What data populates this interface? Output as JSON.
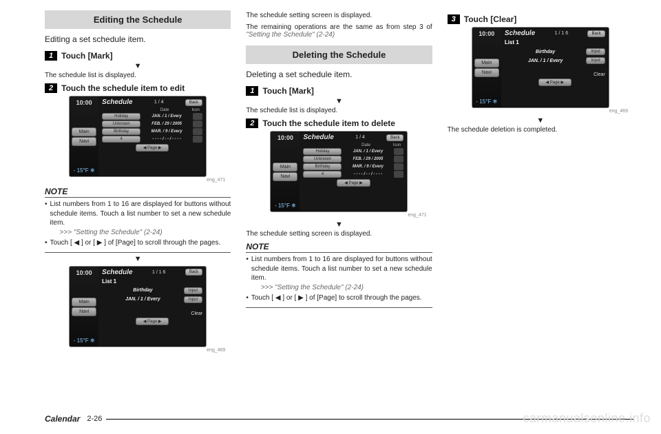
{
  "col1": {
    "section_title": "Editing the Schedule",
    "intro": "Editing a set schedule item.",
    "step1_num": "1",
    "step1": "Touch [Mark]",
    "step1_after": "The schedule list is displayed.",
    "step2_num": "2",
    "step2": "Touch the schedule item to edit",
    "note_h": "NOTE",
    "note1": "List numbers from 1 to 16 are displayed for buttons without schedule items. Touch a list number to set a new schedule item.",
    "note1_ref": ">>> \"Setting the Schedule\" (2-24)",
    "note2": "Touch [ ◀ ] or [ ▶ ] of [Page] to scroll through the pages."
  },
  "col2": {
    "top1": "The schedule setting screen is displayed.",
    "top2": "The remaining operations are the same as from step 3 of",
    "top2_ref": "\"Setting the Schedule\" (2-24)",
    "section_title": "Deleting the Schedule",
    "intro": "Deleting a set schedule item.",
    "step1_num": "1",
    "step1": "Touch [Mark]",
    "step1_after": "The schedule list is displayed.",
    "step2_num": "2",
    "step2": "Touch the schedule item to delete",
    "after_shot": "The schedule setting screen is displayed.",
    "note_h": "NOTE",
    "note1": "List numbers from 1 to 16 are displayed for buttons without schedule items. Touch a list number to set a new schedule item.",
    "note1_ref": ">>> \"Setting the Schedule\" (2-24)",
    "note2": "Touch [ ◀ ] or [ ▶ ] of [Page] to scroll through the pages."
  },
  "col3": {
    "step3_num": "3",
    "step3": "Touch [Clear]",
    "after": "The schedule deletion is completed."
  },
  "screens": {
    "list": {
      "time": "10:00",
      "title": "Schedule",
      "page": "1 / 4",
      "back": "Back",
      "main": "Main",
      "navi": "Navi",
      "temp": "- 15°F ❄",
      "hdr_date": "Date",
      "hdr_icon": "Icon",
      "r1_lbl": "Holiday",
      "r1_date": "JAN. /   1 / Every",
      "r2_lbl": "Unknown",
      "r2_date": "FEB. / 29 / 2005",
      "r3_lbl": "Birthday",
      "r3_date": "MAR. /   9 / Every",
      "r4_lbl": "4",
      "r4_date": "- - - - / - - / - - - -",
      "pager": "◀  Page  ▶",
      "cap": "eng_471"
    },
    "detail": {
      "time": "10:00",
      "title": "Schedule",
      "page": "1 / 1 6",
      "back": "Back",
      "main": "Main",
      "navi": "Navi",
      "temp": "- 15°F ❄",
      "list1": "List 1",
      "row1": "Birthday",
      "row2": "JAN. /   1 / Every",
      "input": "Input",
      "clear": "Clear",
      "pager": "◀  Page  ▶",
      "cap": "eng_469"
    }
  },
  "footer": {
    "section": "Calendar",
    "page": "2-26"
  },
  "watermark": "carmanualsonline.info",
  "tri": "▼"
}
